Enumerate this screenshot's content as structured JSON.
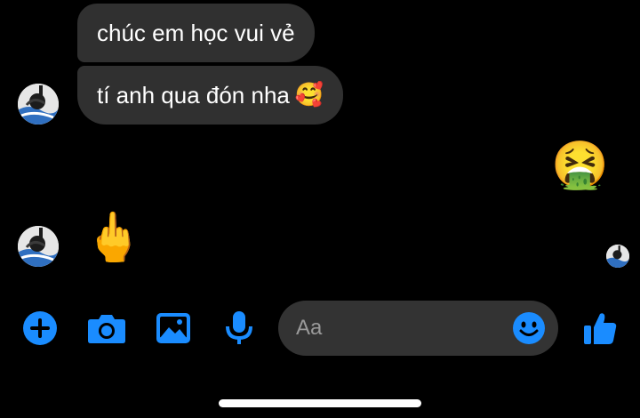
{
  "messages": [
    {
      "text": "chúc em học vui vẻ"
    },
    {
      "text": "tí anh qua đón nha",
      "emoji": "🥰"
    }
  ],
  "sent_emoji": "🤮",
  "received_emoji": "🖕",
  "composer": {
    "placeholder": "Aa",
    "icons": [
      "plus-icon",
      "camera-icon",
      "gallery-icon",
      "microphone-icon",
      "emoji-icon",
      "thumbs-up-icon"
    ]
  },
  "colors": {
    "background": "#000000",
    "bubble": "#303030",
    "accent": "#1a8cff",
    "input": "#333333"
  }
}
